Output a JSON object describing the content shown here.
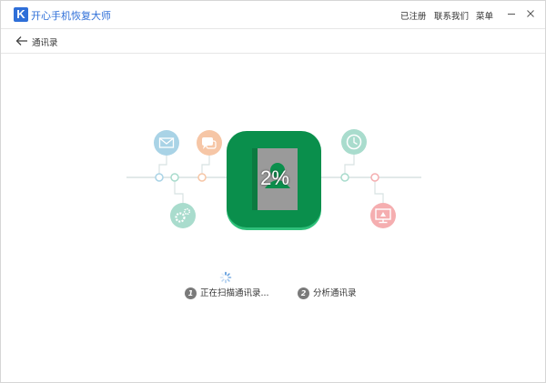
{
  "app": {
    "logo_letter": "K",
    "title": "开心手机恢复大师"
  },
  "top_links": {
    "registered": "已注册",
    "contact": "联系我们",
    "menu": "菜单"
  },
  "subheader": {
    "title": "通讯录"
  },
  "progress": {
    "percent_label": "2%",
    "percent_value": 2
  },
  "steps": [
    {
      "number": "1",
      "label": "正在扫描通讯录..."
    },
    {
      "number": "2",
      "label": "分析通讯录"
    }
  ],
  "colors": {
    "accent_blue": "#2f6fd8",
    "tile_green": "#0a8f4c",
    "mail_icon": "#a9d3e6",
    "chat_icon": "#f6c6a6",
    "gear_icon": "#a9dccd",
    "clock_icon": "#a9dccd",
    "monitor_icon": "#f5aeb0"
  },
  "icons": [
    "mail-icon",
    "chat-icon",
    "gear-icon",
    "clock-icon",
    "monitor-icon",
    "contacts-book-icon"
  ]
}
